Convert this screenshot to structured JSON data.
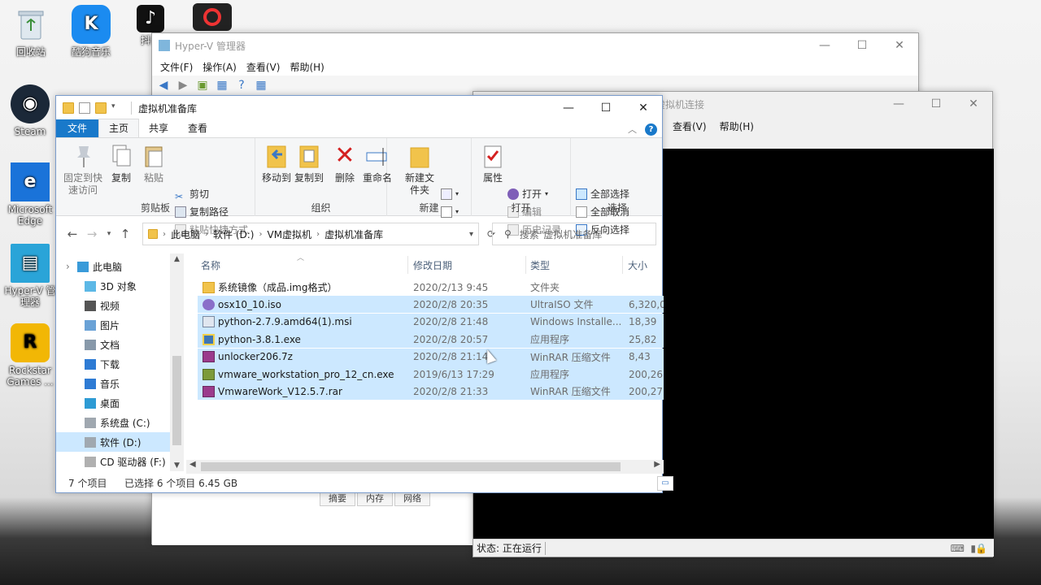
{
  "desktop": {
    "icons": [
      {
        "label": "回收站",
        "icon": "recycle-bin-icon"
      },
      {
        "label": "酷狗音乐",
        "icon": "kugou-icon"
      },
      {
        "label": "抖音",
        "icon": "douyin-icon"
      },
      {
        "label": "Steam",
        "icon": "steam-icon"
      },
      {
        "label": "Microsoft Edge",
        "icon": "edge-icon"
      },
      {
        "label": "Hyper-V 管理器",
        "icon": "hyperv-icon"
      },
      {
        "label": "Rockstar Games ...",
        "icon": "rockstar-icon"
      }
    ]
  },
  "hyperv": {
    "title": "Hyper-V 管理器",
    "menus": [
      "文件(F)",
      "操作(A)",
      "查看(V)",
      "帮助(H)"
    ],
    "lower_tabs": [
      "摘要",
      "内存",
      "网络"
    ]
  },
  "vmconnect": {
    "title": "虚拟机连接",
    "menus": [
      "查看(V)",
      "帮助(H)"
    ],
    "status": "状态: 正在运行"
  },
  "explorer": {
    "title": "虚拟机准备库",
    "tabs": {
      "file": "文件",
      "home": "主页",
      "share": "共享",
      "view": "查看"
    },
    "ribbon": {
      "clipboard": {
        "label": "剪贴板",
        "pin": "固定到快速访问",
        "copy": "复制",
        "paste": "粘贴",
        "cut": "剪切",
        "copy_path": "复制路径",
        "paste_shortcut": "粘贴快捷方式"
      },
      "organize": {
        "label": "组织",
        "move_to": "移动到",
        "copy_to": "复制到",
        "delete": "删除",
        "rename": "重命名"
      },
      "new": {
        "label": "新建",
        "new_folder": "新建文件夹"
      },
      "open": {
        "label": "打开",
        "properties": "属性",
        "open": "打开",
        "edit": "编辑",
        "history": "历史记录"
      },
      "select": {
        "label": "选择",
        "select_all": "全部选择",
        "select_none": "全部取消",
        "invert": "反向选择"
      }
    },
    "breadcrumb": [
      "此电脑",
      "软件 (D:)",
      "VM虚拟机",
      "虚拟机准备库"
    ],
    "search_placeholder": "搜索\"虚拟机准备库\"",
    "nav": [
      {
        "label": "此电脑",
        "icon": "computer-icon",
        "indent": 0
      },
      {
        "label": "3D 对象",
        "icon": "3d-objects-icon",
        "indent": 1
      },
      {
        "label": "视频",
        "icon": "video-icon",
        "indent": 1
      },
      {
        "label": "图片",
        "icon": "pictures-icon",
        "indent": 1
      },
      {
        "label": "文档",
        "icon": "documents-icon",
        "indent": 1
      },
      {
        "label": "下载",
        "icon": "downloads-icon",
        "indent": 1
      },
      {
        "label": "音乐",
        "icon": "music-icon",
        "indent": 1
      },
      {
        "label": "桌面",
        "icon": "desktop-icon",
        "indent": 1
      },
      {
        "label": "系统盘 (C:)",
        "icon": "drive-icon",
        "indent": 1
      },
      {
        "label": "软件 (D:)",
        "icon": "drive-icon",
        "indent": 1,
        "selected": true
      },
      {
        "label": "CD 驱动器 (F:)",
        "icon": "cd-drive-icon",
        "indent": 1
      }
    ],
    "columns": {
      "name": "名称",
      "date": "修改日期",
      "type": "类型",
      "size": "大小"
    },
    "files": [
      {
        "name": "系统镜像（成品.img格式）",
        "date": "2020/2/13 9:45",
        "type": "文件夹",
        "size": "",
        "icon": "folder-icon",
        "selected": false
      },
      {
        "name": "osx10_10.iso",
        "date": "2020/2/8 20:35",
        "type": "UltraISO 文件",
        "size": "6,320,0",
        "icon": "iso-file-icon",
        "selected": true
      },
      {
        "name": "python-2.7.9.amd64(1).msi",
        "date": "2020/2/8 21:48",
        "type": "Windows Installe...",
        "size": "18,39",
        "icon": "msi-file-icon",
        "selected": true
      },
      {
        "name": "python-3.8.1.exe",
        "date": "2020/2/8 20:57",
        "type": "应用程序",
        "size": "25,82",
        "icon": "python-exe-icon",
        "selected": true
      },
      {
        "name": "unlocker206.7z",
        "date": "2020/2/8 21:14",
        "type": "WinRAR 压缩文件",
        "size": "8,43",
        "icon": "archive-icon",
        "selected": true
      },
      {
        "name": "vmware_workstation_pro_12_cn.exe",
        "date": "2019/6/13 17:29",
        "type": "应用程序",
        "size": "200,26",
        "icon": "vmware-exe-icon",
        "selected": true
      },
      {
        "name": "VmwareWork_V12.5.7.rar",
        "date": "2020/2/8 21:33",
        "type": "WinRAR 压缩文件",
        "size": "200,27",
        "icon": "archive-icon",
        "selected": true
      }
    ],
    "status": {
      "count": "7 个项目",
      "selected": "已选择 6 个项目  6.45 GB"
    }
  }
}
